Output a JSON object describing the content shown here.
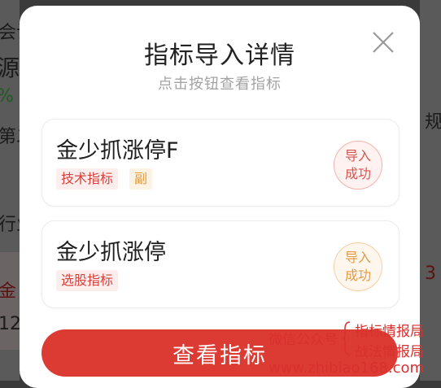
{
  "background": {
    "fragments": [
      "会计",
      "源",
      "%",
      "第二",
      "行业",
      "金",
      "12",
      "规",
      "3"
    ]
  },
  "modal": {
    "title": "指标导入详情",
    "subtitle": "点击按钮查看指标",
    "close_icon": "close-icon",
    "cards": [
      {
        "name": "金少抓涨停F",
        "tags": [
          {
            "label": "技术指标",
            "color": "#d8413b"
          },
          {
            "label": "副",
            "color": "#e59a36"
          }
        ],
        "status": [
          "导入",
          "成功"
        ],
        "status_color": "#d6554f"
      },
      {
        "name": "金少抓涨停",
        "tags": [
          {
            "label": "选股指标",
            "color": "#d8413b"
          }
        ],
        "status": [
          "导入",
          "成功"
        ],
        "status_color": "#e49a45"
      }
    ],
    "cta_label": "查看指标",
    "accent": "#dc3b33"
  },
  "watermark": {
    "left": "微信公众号",
    "right_top": "指标情报局",
    "right_bottom": "战法情报局",
    "site": "www.zhibiao168.com"
  }
}
